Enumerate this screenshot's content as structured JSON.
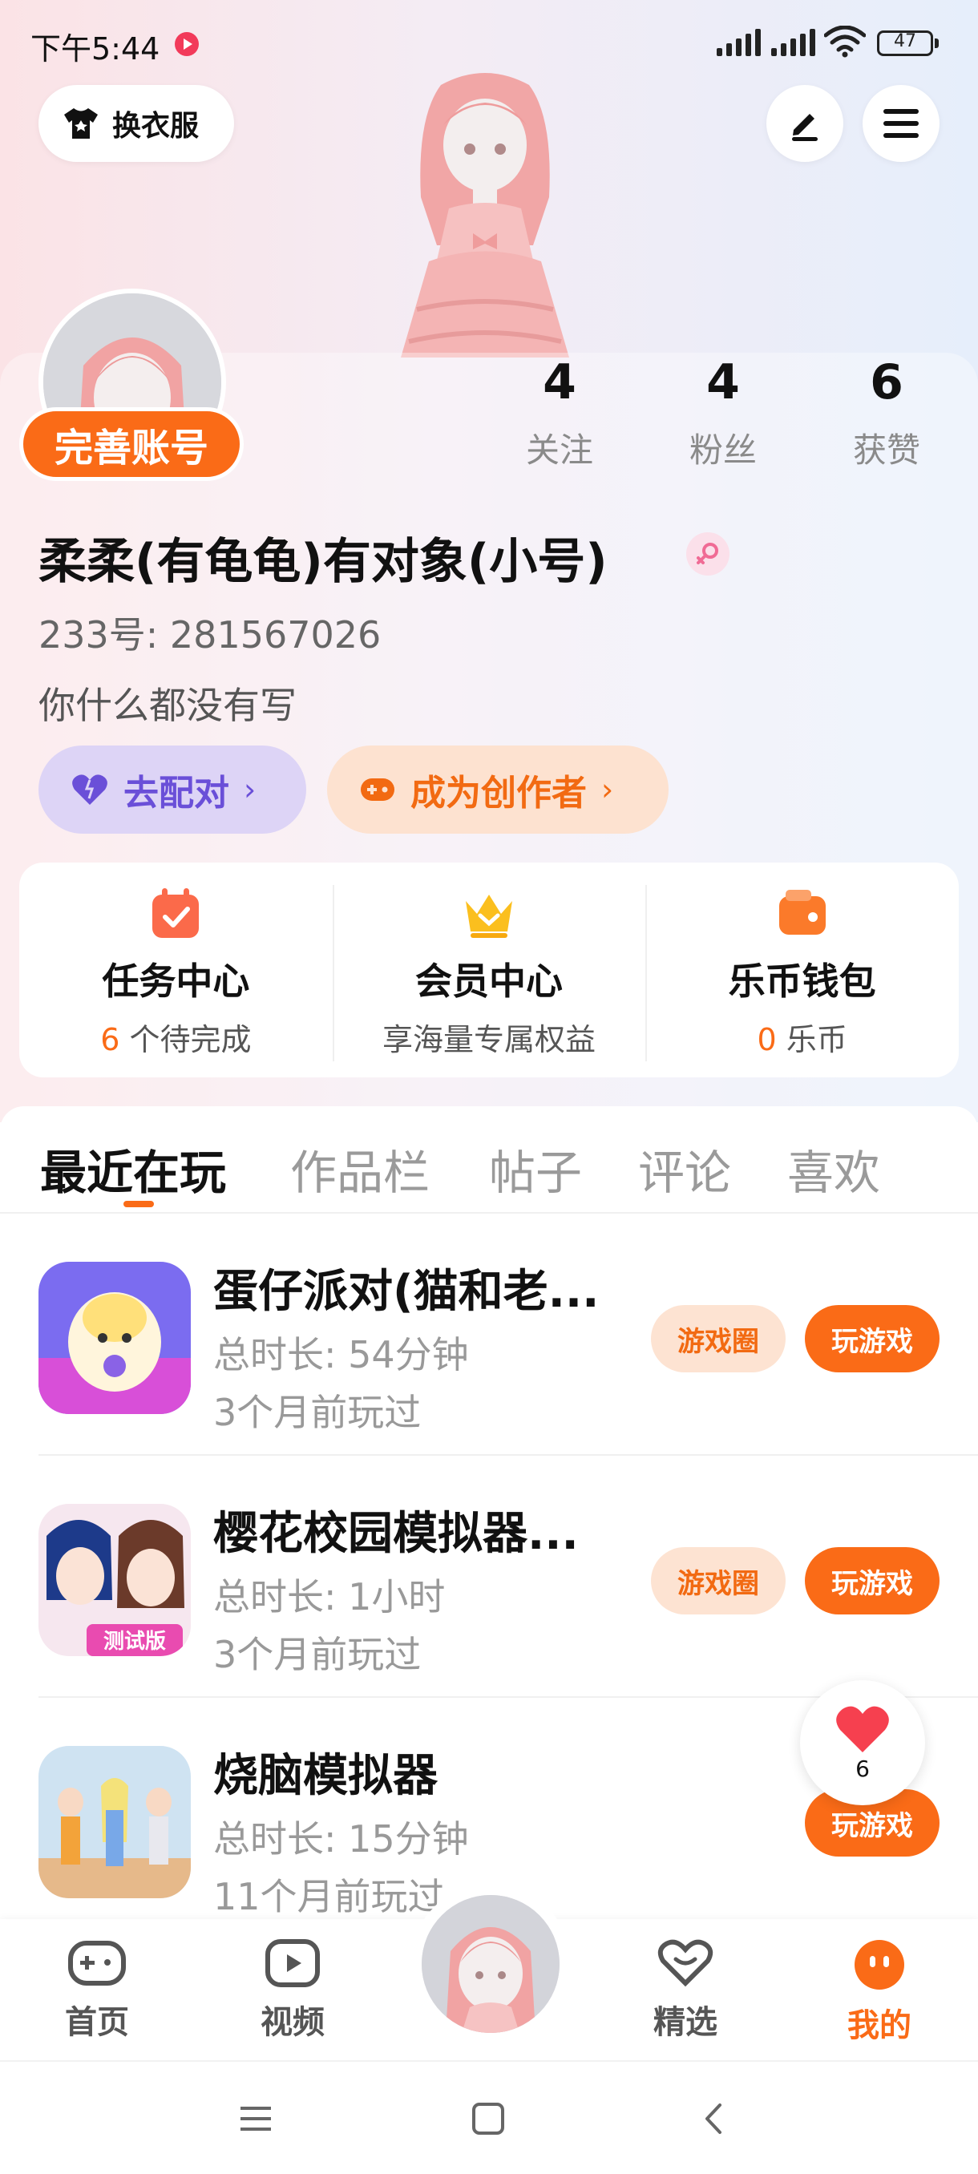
{
  "status_bar": {
    "time": "下午5:44",
    "battery": "47"
  },
  "header": {
    "costume_label": "换衣服"
  },
  "profile": {
    "complete_badge": "完善账号",
    "nickname": "柔柔(有龟龟)有对象(小号)",
    "account_id": "233号: 281567026",
    "bio": "你什么都没有写",
    "stats": [
      {
        "value": "4",
        "label": "关注"
      },
      {
        "value": "4",
        "label": "粉丝"
      },
      {
        "value": "6",
        "label": "获赞"
      }
    ],
    "match_label": "去配对",
    "creator_label": "成为创作者"
  },
  "services": [
    {
      "title": "任务中心",
      "highlight": "6",
      "sub": " 个待完成"
    },
    {
      "title": "会员中心",
      "highlight": "",
      "sub": "享海量专属权益"
    },
    {
      "title": "乐币钱包",
      "highlight": "0",
      "sub": " 乐币"
    }
  ],
  "tabs": [
    "最近在玩",
    "作品栏",
    "帖子",
    "评论",
    "喜欢"
  ],
  "games": [
    {
      "title": "蛋仔派对(猫和老...",
      "duration": "总时长: 54分钟",
      "last_played": "3个月前玩过",
      "circle_label": "游戏圈",
      "play_label": "玩游戏"
    },
    {
      "title": "樱花校园模拟器...",
      "duration": "总时长: 1小时",
      "last_played": "3个月前玩过",
      "circle_label": "游戏圈",
      "play_label": "玩游戏",
      "icon_badge": "测试版"
    },
    {
      "title": "烧脑模拟器",
      "duration": "总时长: 15分钟",
      "last_played": "11个月前玩过",
      "play_label": "玩游戏"
    }
  ],
  "float_like": {
    "count": "6"
  },
  "bottom_nav": [
    {
      "label": "首页",
      "icon": "gamepad-icon"
    },
    {
      "label": "视频",
      "icon": "play-icon"
    },
    {
      "label": "精选",
      "icon": "heart-chat-icon"
    },
    {
      "label": "我的",
      "icon": "face-icon"
    }
  ],
  "colors": {
    "accent": "#fa6b17",
    "accent_soft": "#fde3d2",
    "purple": "#6a4fd8",
    "purple_soft": "#ddd4f6"
  }
}
